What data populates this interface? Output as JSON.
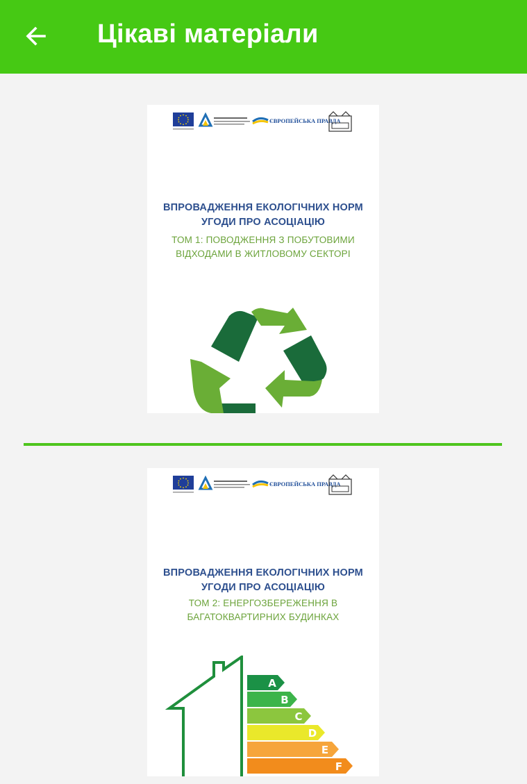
{
  "appbar": {
    "title": "Цікаві матеріали",
    "back_icon": "arrow-left-icon",
    "background": "#46c914"
  },
  "materials": [
    {
      "title_line1": "ВПРОВАДЖЕННЯ ЕКОЛОГІЧНИХ НОРМ",
      "title_line2": "УГОДИ ПРО АСОЦІАЦІЮ",
      "subtitle_line1": "ТОМ 1: ПОВОДЖЕННЯ З ПОБУТОВИМИ",
      "subtitle_line2": "ВІДХОДАМИ В ЖИТЛОВОМУ СЕКТОРІ",
      "logo_text": "ЄВРОПЕЙСЬКА ПРАВДА",
      "illustration": "recycle-icon"
    },
    {
      "title_line1": "ВПРОВАДЖЕННЯ ЕКОЛОГІЧНИХ НОРМ",
      "title_line2": "УГОДИ ПРО АСОЦІАЦІЮ",
      "subtitle_line1": "ТОМ 2: ЕНЕРГОЗБЕРЕЖЕННЯ В",
      "subtitle_line2": "БАГАТОКВАРТИРНИХ БУДИНКАХ",
      "logo_text": "ЄВРОПЕЙСЬКА ПРАВДА",
      "illustration": "energy-rating-house-icon",
      "energy_classes": [
        "A",
        "B",
        "C",
        "D",
        "E",
        "F"
      ]
    }
  ],
  "colors": {
    "accent": "#46c914",
    "title_blue": "#2d4f8e",
    "subtitle_green": "#6ba33a"
  }
}
